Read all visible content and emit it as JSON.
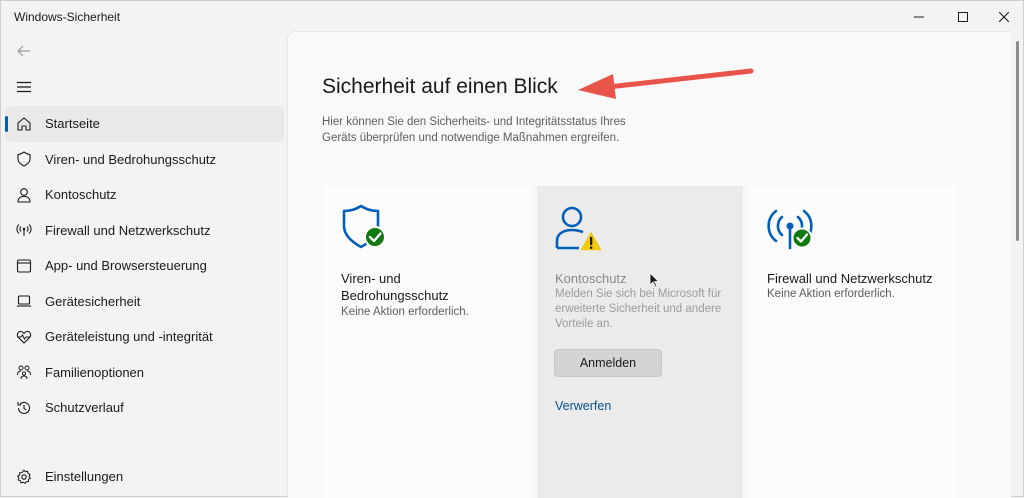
{
  "window": {
    "title": "Windows-Sicherheit",
    "controls": [
      "minimize-icon",
      "maximize-icon",
      "close-icon"
    ]
  },
  "sidebar": {
    "back_icon": "back-arrow-icon",
    "menu_icon": "hamburger-icon",
    "items": [
      {
        "label": "Startseite",
        "icon": "home-icon",
        "active": true
      },
      {
        "label": "Viren- und Bedrohungsschutz",
        "icon": "shield-icon"
      },
      {
        "label": "Kontoschutz",
        "icon": "person-icon"
      },
      {
        "label": "Firewall und Netzwerkschutz",
        "icon": "antenna-icon"
      },
      {
        "label": "App- und Browsersteuerung",
        "icon": "browser-window-icon"
      },
      {
        "label": "Gerätesicherheit",
        "icon": "laptop-icon"
      },
      {
        "label": "Geräteleistung und -integrität",
        "icon": "heart-pulse-icon"
      },
      {
        "label": "Familienoptionen",
        "icon": "family-icon"
      },
      {
        "label": "Schutzverlauf",
        "icon": "history-icon"
      }
    ],
    "settings": {
      "label": "Einstellungen",
      "icon": "gear-icon"
    }
  },
  "main": {
    "title": "Sicherheit auf einen Blick",
    "description": "Hier können Sie den Sicherheits- und Integritätsstatus Ihres Geräts überprüfen und notwendige Maßnahmen ergreifen.",
    "cards": [
      {
        "title_line1": "Viren- und",
        "title_line2": "Bedrohungsschutz",
        "status": "Keine Aktion erforderlich.",
        "icon": "shield-check-icon"
      },
      {
        "title": "Kontoschutz",
        "text": "Melden Sie sich bei Microsoft für erweiterte Sicherheit und andere Vorteile an.",
        "button": "Anmelden",
        "link": "Verwerfen",
        "icon": "person-warning-icon"
      },
      {
        "title": "Firewall und Netzwerkschutz",
        "status": "Keine Aktion erforderlich.",
        "icon": "antenna-check-icon"
      }
    ]
  },
  "colors": {
    "accent": "#005fb8",
    "ok_green": "#0f7b0f",
    "warning_yellow": "#f2c811",
    "annotation_arrow": "#e8544a"
  }
}
